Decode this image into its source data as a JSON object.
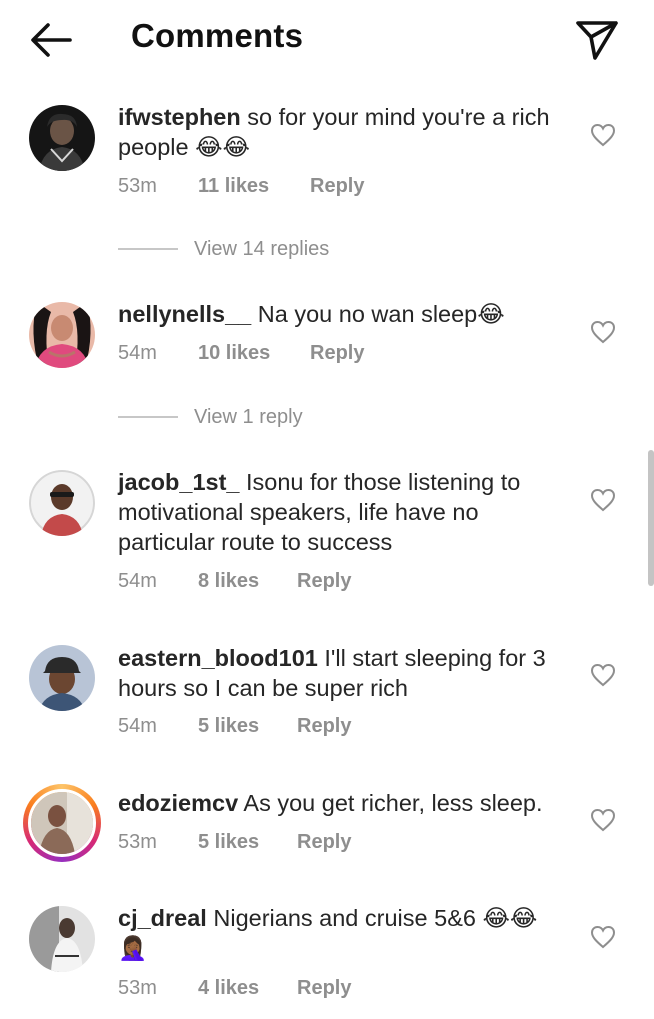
{
  "header": {
    "title": "Comments"
  },
  "comments": [
    {
      "username": "ifwstephen",
      "text": "so for your mind you're a rich people 😂😂",
      "time": "53m",
      "likes": "11 likes",
      "reply": "Reply",
      "view_replies": "View 14 replies"
    },
    {
      "username": "nellynells__",
      "text": "Na you no wan sleep😂",
      "time": "54m",
      "likes": "10 likes",
      "reply": "Reply",
      "view_replies": "View 1 reply"
    },
    {
      "username": "jacob_1st_",
      "text": "Isonu for those listening to motivational speakers, life have no particular route to success",
      "time": "54m",
      "likes": "8 likes",
      "reply": "Reply"
    },
    {
      "username": "eastern_blood101",
      "text": "I'll start sleeping for 3 hours so I can be super rich",
      "time": "54m",
      "likes": "5 likes",
      "reply": "Reply"
    },
    {
      "username": "edoziemcv",
      "text": "As you get richer, less sleep.",
      "time": "53m",
      "likes": "5 likes",
      "reply": "Reply"
    },
    {
      "username": "cj_dreal",
      "text": "Nigerians and cruise 5&6 😂😂🤦🏾‍♀️",
      "time": "53m",
      "likes": "4 likes",
      "reply": "Reply"
    }
  ],
  "icons": {
    "back": "arrow-left-icon",
    "share": "paper-plane-icon",
    "like": "heart-outline-icon"
  }
}
